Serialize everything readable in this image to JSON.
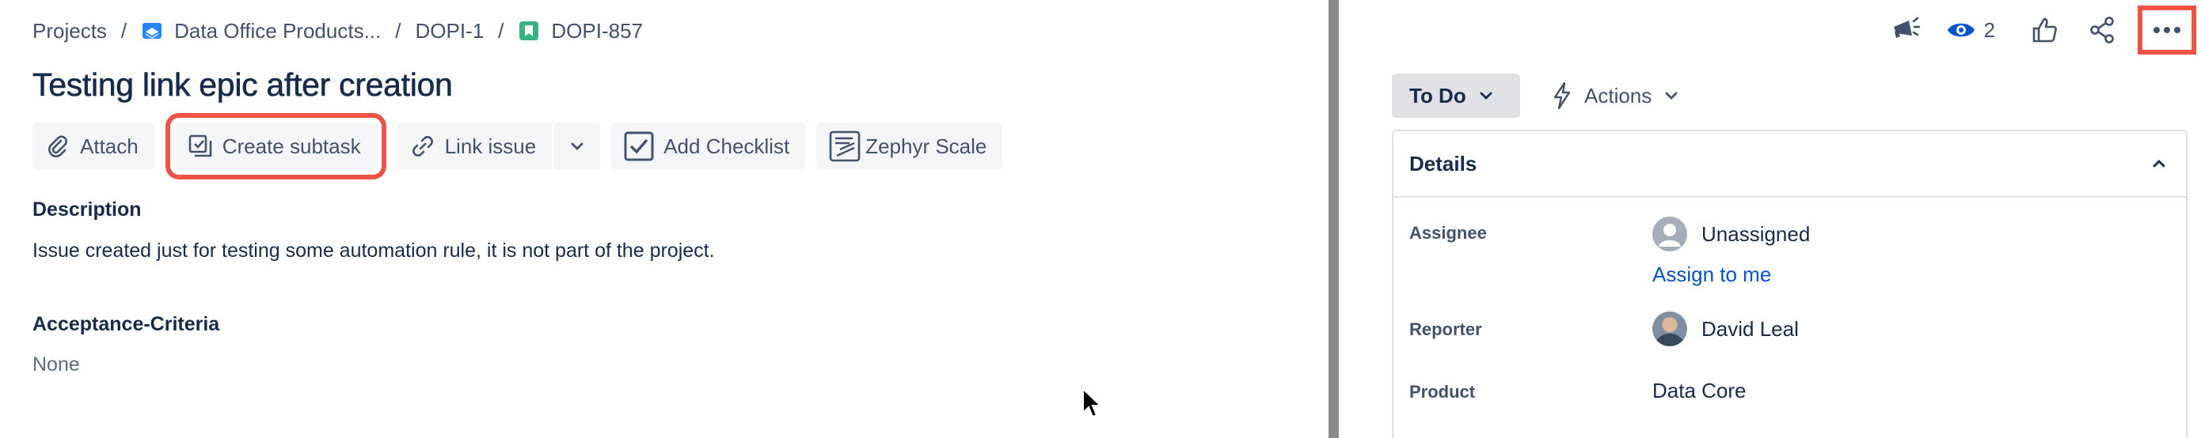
{
  "breadcrumb": {
    "items": [
      {
        "label": "Projects"
      },
      {
        "label": "Data Office Products..."
      },
      {
        "label": "DOPI-1"
      },
      {
        "label": "DOPI-857"
      }
    ],
    "separator": "/"
  },
  "issue": {
    "title": "Testing link epic after creation"
  },
  "toolbar": {
    "attach": "Attach",
    "create_subtask": "Create subtask",
    "link_issue": "Link issue",
    "add_checklist": "Add Checklist",
    "zephyr_scale": "Zephyr Scale"
  },
  "description": {
    "label": "Description",
    "text": "Issue created just for testing some automation rule, it is not part of the project."
  },
  "acceptance": {
    "label": "Acceptance-Criteria",
    "value": "None"
  },
  "topbar": {
    "watch_count": "2"
  },
  "status": {
    "label": "To Do",
    "actions_label": "Actions"
  },
  "details": {
    "title": "Details",
    "assignee_label": "Assignee",
    "assignee_value": "Unassigned",
    "assign_to_me": "Assign to me",
    "reporter_label": "Reporter",
    "reporter_value": "David Leal",
    "product_label": "Product",
    "product_value": "Data Core"
  },
  "colors": {
    "highlight": "#ee5446",
    "link": "#0052cc",
    "text": "#172b4d",
    "subtle_text": "#42526e",
    "divider": "#8b8b8b"
  }
}
